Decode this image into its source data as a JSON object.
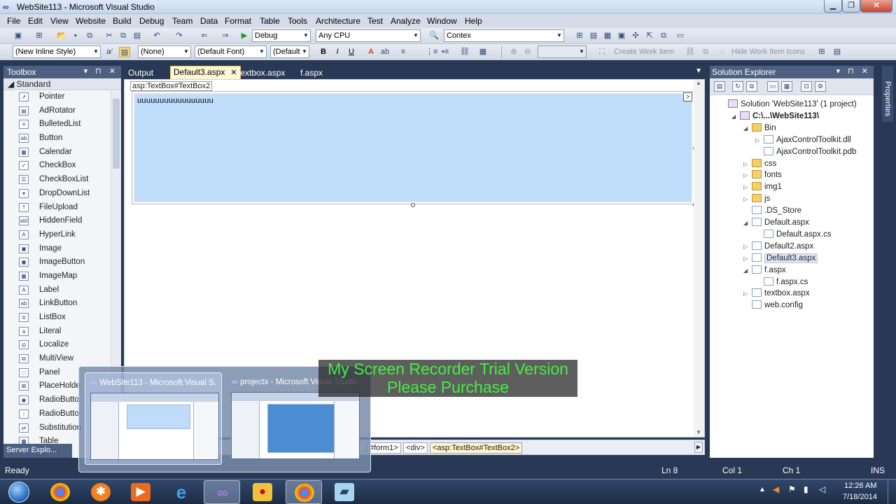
{
  "window": {
    "title": "WebSite113 - Microsoft Visual Studio",
    "minimize": "▁",
    "maximize": "❐",
    "close": "✕"
  },
  "menu": [
    "File",
    "Edit",
    "View",
    "Website",
    "Build",
    "Debug",
    "Team",
    "Data",
    "Format",
    "Table",
    "Tools",
    "Architecture",
    "Test",
    "Analyze",
    "Window",
    "Help"
  ],
  "toolbar1": {
    "config": "Debug",
    "platform": "Any CPU",
    "find": "Contex"
  },
  "toolbar2": {
    "style": "(New Inline Style)",
    "block": "(None)",
    "font": "(Default Font)",
    "size": "(Default",
    "bold": "B",
    "italic": "I",
    "underline": "U",
    "create_work_item": "Create Work Item",
    "hide_work_item_icons": "Hide Work Item Icons"
  },
  "toolbox": {
    "title": "Toolbox",
    "header_btns": "▾ ⊓ ✕",
    "group": "Standard",
    "items": [
      {
        "label": "Pointer",
        "icon": "pointer-icon",
        "glyph": "➚"
      },
      {
        "label": "AdRotator",
        "icon": "adrotator-icon",
        "glyph": "▤"
      },
      {
        "label": "BulletedList",
        "icon": "bulleted-list-icon",
        "glyph": "≡"
      },
      {
        "label": "Button",
        "icon": "button-icon",
        "glyph": "ab"
      },
      {
        "label": "Calendar",
        "icon": "calendar-icon",
        "glyph": "▦"
      },
      {
        "label": "CheckBox",
        "icon": "checkbox-icon",
        "glyph": "✓"
      },
      {
        "label": "CheckBoxList",
        "icon": "checkbox-list-icon",
        "glyph": "☰"
      },
      {
        "label": "DropDownList",
        "icon": "dropdown-list-icon",
        "glyph": "▾"
      },
      {
        "label": "FileUpload",
        "icon": "file-upload-icon",
        "glyph": "⇡"
      },
      {
        "label": "HiddenField",
        "icon": "hidden-field-icon",
        "glyph": "abl"
      },
      {
        "label": "HyperLink",
        "icon": "hyperlink-icon",
        "glyph": "A"
      },
      {
        "label": "Image",
        "icon": "image-icon",
        "glyph": "▣"
      },
      {
        "label": "ImageButton",
        "icon": "image-button-icon",
        "glyph": "▣"
      },
      {
        "label": "ImageMap",
        "icon": "image-map-icon",
        "glyph": "▦"
      },
      {
        "label": "Label",
        "icon": "label-icon",
        "glyph": "A"
      },
      {
        "label": "LinkButton",
        "icon": "link-button-icon",
        "glyph": "ab"
      },
      {
        "label": "ListBox",
        "icon": "listbox-icon",
        "glyph": "≣"
      },
      {
        "label": "Literal",
        "icon": "literal-icon",
        "glyph": "a"
      },
      {
        "label": "Localize",
        "icon": "localize-icon",
        "glyph": "◎"
      },
      {
        "label": "MultiView",
        "icon": "multiview-icon",
        "glyph": "⧉"
      },
      {
        "label": "Panel",
        "icon": "panel-icon",
        "glyph": "□"
      },
      {
        "label": "PlaceHolde",
        "icon": "placeholder-icon",
        "glyph": "⊠"
      },
      {
        "label": "RadioButto",
        "icon": "radio-button-icon",
        "glyph": "◉"
      },
      {
        "label": "RadioButto",
        "icon": "radio-button-list-icon",
        "glyph": "⁝"
      },
      {
        "label": "Substitution",
        "icon": "substitution-icon",
        "glyph": "⇄"
      },
      {
        "label": "Table",
        "icon": "table-icon",
        "glyph": "▦"
      }
    ]
  },
  "editor": {
    "tabs": [
      {
        "label": "Output",
        "active": false
      },
      {
        "label": "Default3.aspx",
        "active": true
      },
      {
        "label": "textbox.aspx",
        "active": false
      },
      {
        "label": "f.aspx",
        "active": false
      }
    ],
    "close_glyph": "✕",
    "design_tag": "asp:TextBox#TextBox2",
    "textbox_value": "uuuuuuuuuuuuuuuuu",
    "smart_tag": ">"
  },
  "tag_navigator": {
    "items": [
      "#form1>",
      "<div>",
      "<asp:TextBox#TextBox2>"
    ]
  },
  "solution_explorer": {
    "title": "Solution Explorer",
    "header_btns": "▾ ⊓ ✕",
    "tree": [
      {
        "label": "Solution 'WebSite113' (1 project)",
        "indent": 0,
        "exp": "",
        "icon": "sln"
      },
      {
        "label": "C:\\...\\WebSite113\\",
        "indent": 1,
        "exp": "◢",
        "icon": "sln",
        "bold": true
      },
      {
        "label": "Bin",
        "indent": 2,
        "exp": "◢",
        "icon": "folder"
      },
      {
        "label": "AjaxControlToolkit.dll",
        "indent": 3,
        "exp": "▷",
        "icon": "file"
      },
      {
        "label": "AjaxControlToolkit.pdb",
        "indent": 3,
        "exp": "",
        "icon": "file"
      },
      {
        "label": "css",
        "indent": 2,
        "exp": "▷",
        "icon": "folder"
      },
      {
        "label": "fonts",
        "indent": 2,
        "exp": "▷",
        "icon": "folder"
      },
      {
        "label": "img1",
        "indent": 2,
        "exp": "▷",
        "icon": "folder"
      },
      {
        "label": "js",
        "indent": 2,
        "exp": "▷",
        "icon": "folder"
      },
      {
        "label": ".DS_Store",
        "indent": 2,
        "exp": "",
        "icon": "file"
      },
      {
        "label": "Default.aspx",
        "indent": 2,
        "exp": "◢",
        "icon": "file"
      },
      {
        "label": "Default.aspx.cs",
        "indent": 3,
        "exp": "",
        "icon": "file"
      },
      {
        "label": "Default2.aspx",
        "indent": 2,
        "exp": "▷",
        "icon": "file"
      },
      {
        "label": "Default3.aspx",
        "indent": 2,
        "exp": "▷",
        "icon": "file",
        "selected": true
      },
      {
        "label": "f.aspx",
        "indent": 2,
        "exp": "◢",
        "icon": "file"
      },
      {
        "label": "f.aspx.cs",
        "indent": 3,
        "exp": "",
        "icon": "file"
      },
      {
        "label": "textbox.aspx",
        "indent": 2,
        "exp": "▷",
        "icon": "file"
      },
      {
        "label": "web.config",
        "indent": 2,
        "exp": "",
        "icon": "file"
      }
    ]
  },
  "properties_tab": "Properties",
  "server_explorer_tab": "Server Explo...",
  "status": {
    "ready": "Ready",
    "ln": "Ln 8",
    "col": "Col 1",
    "ch": "Ch 1",
    "ins": "INS"
  },
  "taskbar": {
    "clock_time": "12:26 AM",
    "clock_date": "7/18/2014",
    "apps": [
      "chrome",
      "avast",
      "media-player",
      "internet-explorer",
      "visual-studio",
      "paint",
      "chrome-2",
      "notepad"
    ]
  },
  "preview": {
    "items": [
      {
        "title": "WebSite113 - Microsoft Visual S...",
        "hover": true
      },
      {
        "title": "projectx - Microsoft Visual Studio",
        "hover": false
      }
    ]
  },
  "watermark": {
    "line1": "My Screen Recorder Trial Version",
    "line2": "Please Purchase"
  },
  "colors": {
    "chrome": "#293955",
    "panel_header": "#4d6082",
    "selection": "#bfdcfb",
    "watermark_text": "#41f041"
  }
}
